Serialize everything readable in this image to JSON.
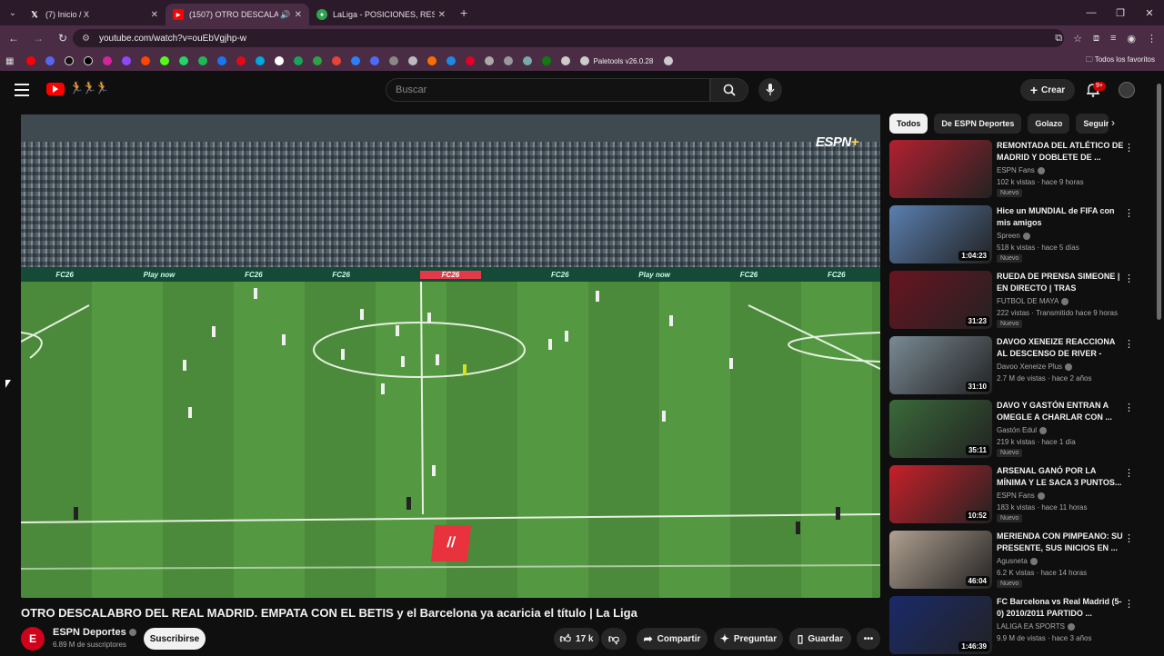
{
  "browser": {
    "tabs": [
      {
        "title": "(7) Inicio / X",
        "favicon": "x-icon",
        "active": false
      },
      {
        "title": "(1507) OTRO DESCALABRO",
        "favicon": "youtube-icon",
        "active": true
      },
      {
        "title": "LaLiga - POSICIONES, RESULTA...",
        "favicon": "laliga-icon",
        "active": false
      }
    ],
    "url": "youtube.com/watch?v=ouEbVgjhp-w",
    "bookmarks": {
      "paletools_label": "Paletools v26.0.28",
      "all_bookmarks_label": "Todos los favoritos"
    }
  },
  "youtube": {
    "search_placeholder": "Buscar",
    "create_label": "Crear",
    "notifications_badge": "9+",
    "player": {
      "espn_logo": "ESPN",
      "espn_plus": "+",
      "adboard": [
        "FC26",
        "Play now",
        "FC26",
        "FC26",
        "FC26",
        "FC26",
        "Play now",
        "FC26",
        "FC26"
      ]
    },
    "video": {
      "title": "OTRO DESCALABRO DEL REAL MADRID. EMPATA CON EL BETIS y el Barcelona ya acaricia el título | La Liga",
      "channel": "ESPN Deportes",
      "subscribers": "6.89 M de suscriptores",
      "subscribe_label": "Suscribirse",
      "likes": "17 k",
      "share_label": "Compartir",
      "ask_label": "Preguntar",
      "save_label": "Guardar"
    },
    "chips": [
      "Todos",
      "De ESPN Deportes",
      "Golazo",
      "Seguir"
    ],
    "recommendations": [
      {
        "title": "REMONTADA DEL ATLÉTICO DE MADRID Y DOBLETE DE ...",
        "channel": "ESPN Fans",
        "meta": "102 k vistas · hace 9 horas",
        "badge": "Nuevo",
        "duration": "",
        "thumb_color": "#b32030"
      },
      {
        "title": "Hice un MUNDIAL de FIFA con mis amigos",
        "channel": "Spreen",
        "meta": "518 k vistas · hace 5 días",
        "badge": "Nuevo",
        "duration": "1:04:23",
        "thumb_color": "#5a7fb0"
      },
      {
        "title": "RUEDA DE PRENSA SIMEONE | EN DIRECTO | TRAS ATLETICO...",
        "channel": "FUTBOL DE MAYA",
        "meta": "222 vistas · Transmitido hace 9 horas",
        "badge": "Nuevo",
        "duration": "31:23",
        "thumb_color": "#6a1420"
      },
      {
        "title": "DAVOO XENEIZE REACCIONA AL DESCENSO DE RIVER - PAS...",
        "channel": "Davoo Xeneize Plus",
        "meta": "2.7 M de vistas · hace 2 años",
        "badge": "",
        "duration": "31:10",
        "thumb_color": "#7a8a95"
      },
      {
        "title": "DAVO Y GASTÓN ENTRAN A OMEGLE A CHARLAR CON ...",
        "channel": "Gastón Edul",
        "meta": "219 k vistas · hace 1 día",
        "badge": "Nuevo",
        "duration": "35:11",
        "thumb_color": "#3a6a3a"
      },
      {
        "title": "ARSENAL GANÓ POR LA MÍNIMA Y LE SACA 3 PUNTOS...",
        "channel": "ESPN Fans",
        "meta": "183 k vistas · hace 11 horas",
        "badge": "Nuevo",
        "duration": "10:52",
        "thumb_color": "#c8202a"
      },
      {
        "title": "MERIENDA CON PIMPEANO: SU PRESENTE, SUS INICIOS EN ...",
        "channel": "Agusneta",
        "meta": "6.2 K vistas · hace 14 horas",
        "badge": "Nuevo",
        "duration": "46:04",
        "thumb_color": "#b0a090"
      },
      {
        "title": "FC Barcelona vs Real Madrid (5-0) 2010/2011 PARTIDO ...",
        "channel": "LALIGA EA SPORTS",
        "meta": "9.9 M de vistas · hace 3 años",
        "badge": "",
        "duration": "1:46:39",
        "thumb_color": "#1a2a6a"
      }
    ]
  }
}
